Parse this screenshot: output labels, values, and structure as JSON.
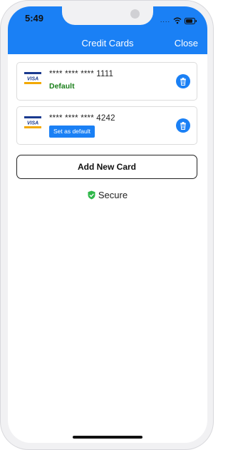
{
  "status_bar": {
    "time": "5:49",
    "signal_dots": "...."
  },
  "header": {
    "title": "Credit Cards",
    "close_label": "Close",
    "color": "#1a80f5"
  },
  "cards": [
    {
      "brand": "VISA",
      "number": "**** **** **** 1111",
      "is_default": true,
      "default_label": "Default"
    },
    {
      "brand": "VISA",
      "number": "**** **** **** 4242",
      "is_default": false,
      "set_default_label": "Set as default"
    }
  ],
  "add_card_label": "Add New Card",
  "secure_label": "Secure",
  "colors": {
    "accent": "#1a80f5",
    "default_green": "#1a7f1a",
    "secure_green": "#2fb84a"
  }
}
